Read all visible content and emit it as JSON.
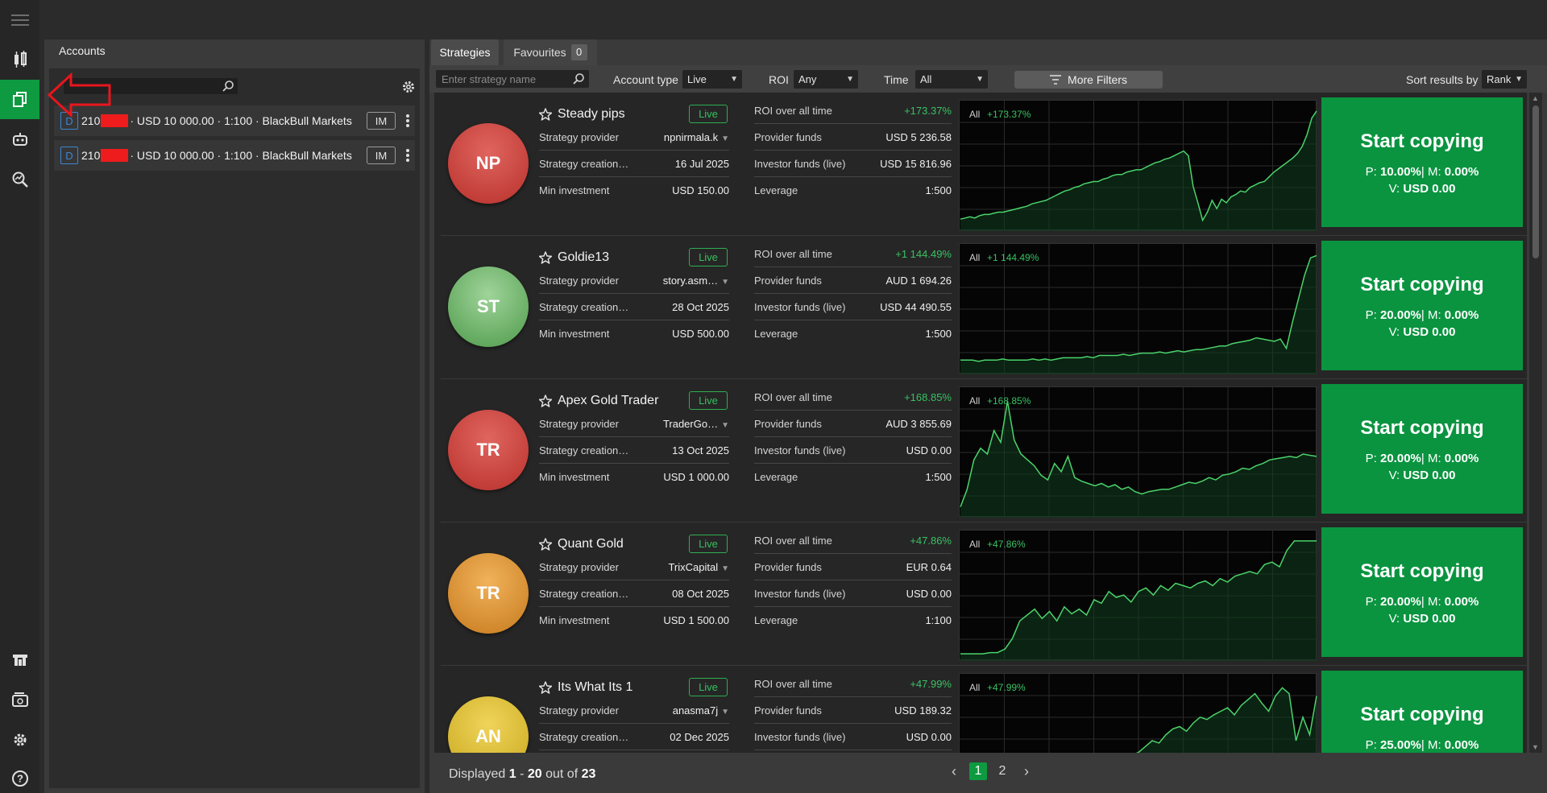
{
  "rail": {
    "icons": [
      "menu-icon",
      "chart-icon",
      "copy-icon",
      "robot-icon",
      "analyze-icon",
      "deposit-icon",
      "wallet-icon",
      "gear-icon",
      "help-icon"
    ]
  },
  "accounts": {
    "title": "Accounts",
    "rows": [
      {
        "badge": "D",
        "number_prefix": "210",
        "details": "· USD 10 000.00 · 1:100 · BlackBull Markets",
        "im": "IM"
      },
      {
        "badge": "D",
        "number_prefix": "210",
        "details": "· USD 10 000.00 · 1:100 · BlackBull Markets",
        "im": "IM"
      }
    ]
  },
  "tabs": {
    "strategies": "Strategies",
    "favourites": "Favourites",
    "favourites_count": "0"
  },
  "filters": {
    "search_placeholder": "Enter strategy name",
    "account_type_label": "Account type",
    "account_type_value": "Live",
    "roi_label": "ROI",
    "roi_value": "Any",
    "time_label": "Time",
    "time_value": "All",
    "more_filters": "More Filters",
    "sort_label": "Sort results by",
    "sort_value": "Rank"
  },
  "labels": {
    "live": "Live",
    "strategy_provider": "Strategy provider",
    "strategy_creation": "Strategy creation…",
    "min_investment": "Min investment",
    "roi_all_time": "ROI over all time",
    "provider_funds": "Provider funds",
    "investor_funds": "Investor funds (live)",
    "leverage": "Leverage",
    "chart_period": "All",
    "start_copying": "Start copying",
    "p": "P:",
    "m": "M:",
    "v": "V:"
  },
  "strategies": [
    {
      "initials": "NP",
      "color_top": "#e0655f",
      "color_bottom": "#b8302b",
      "name": "Steady pips",
      "provider": "npnirmala.k",
      "creation": "16 Jul 2025",
      "min_investment": "USD 150.00",
      "roi": "+173.37%",
      "provider_funds": "USD 5 236.58",
      "investor_funds": "USD 15 816.96",
      "leverage": "1:500",
      "p": "10.00%",
      "m": "0.00%",
      "v": "USD 0.00",
      "series": [
        0.06,
        0.07,
        0.08,
        0.07,
        0.09,
        0.1,
        0.1,
        0.11,
        0.12,
        0.12,
        0.13,
        0.14,
        0.15,
        0.16,
        0.17,
        0.19,
        0.2,
        0.21,
        0.22,
        0.24,
        0.26,
        0.28,
        0.3,
        0.31,
        0.33,
        0.34,
        0.36,
        0.37,
        0.38,
        0.38,
        0.4,
        0.41,
        0.43,
        0.44,
        0.44,
        0.46,
        0.47,
        0.48,
        0.48,
        0.5,
        0.52,
        0.54,
        0.55,
        0.57,
        0.58,
        0.6,
        0.62,
        0.64,
        0.6,
        0.34,
        0.2,
        0.05,
        0.12,
        0.22,
        0.15,
        0.23,
        0.2,
        0.25,
        0.27,
        0.3,
        0.29,
        0.33,
        0.35,
        0.37,
        0.38,
        0.42,
        0.46,
        0.49,
        0.52,
        0.55,
        0.58,
        0.62,
        0.68,
        0.78,
        0.92,
        0.98
      ]
    },
    {
      "initials": "ST",
      "color_top": "#9fd49a",
      "color_bottom": "#4e9a4a",
      "name": "Goldie13",
      "provider": "story.asm…",
      "creation": "28 Oct 2025",
      "min_investment": "USD 500.00",
      "roi": "+1 144.49%",
      "provider_funds": "AUD 1 694.26",
      "investor_funds": "USD 44 490.55",
      "leverage": "1:500",
      "p": "20.00%",
      "m": "0.00%",
      "v": "USD 0.00",
      "series": [
        0.08,
        0.08,
        0.08,
        0.07,
        0.08,
        0.08,
        0.08,
        0.09,
        0.08,
        0.08,
        0.08,
        0.08,
        0.09,
        0.08,
        0.09,
        0.08,
        0.09,
        0.1,
        0.1,
        0.1,
        0.1,
        0.11,
        0.1,
        0.12,
        0.12,
        0.12,
        0.12,
        0.13,
        0.12,
        0.13,
        0.14,
        0.14,
        0.14,
        0.15,
        0.14,
        0.15,
        0.16,
        0.15,
        0.16,
        0.17,
        0.17,
        0.18,
        0.19,
        0.2,
        0.2,
        0.22,
        0.23,
        0.24,
        0.25,
        0.27,
        0.26,
        0.25,
        0.24,
        0.26,
        0.18,
        0.4,
        0.6,
        0.8,
        0.95,
        0.97
      ]
    },
    {
      "initials": "TR",
      "color_top": "#e0655f",
      "color_bottom": "#b8302b",
      "name": "Apex Gold Trader",
      "provider": "TraderGo…",
      "creation": "13 Oct 2025",
      "min_investment": "USD 1 000.00",
      "roi": "+168.85%",
      "provider_funds": "AUD 3 855.69",
      "investor_funds": "USD 0.00",
      "leverage": "1:500",
      "p": "20.00%",
      "m": "0.00%",
      "v": "USD 0.00",
      "series": [
        0.05,
        0.2,
        0.45,
        0.55,
        0.5,
        0.7,
        0.6,
        0.95,
        0.62,
        0.5,
        0.45,
        0.4,
        0.32,
        0.28,
        0.42,
        0.35,
        0.48,
        0.3,
        0.27,
        0.25,
        0.23,
        0.25,
        0.22,
        0.24,
        0.2,
        0.22,
        0.18,
        0.16,
        0.18,
        0.19,
        0.2,
        0.2,
        0.22,
        0.24,
        0.26,
        0.25,
        0.27,
        0.3,
        0.28,
        0.32,
        0.33,
        0.35,
        0.38,
        0.37,
        0.4,
        0.42,
        0.45,
        0.46,
        0.47,
        0.48,
        0.47,
        0.5,
        0.49,
        0.48
      ]
    },
    {
      "initials": "TR",
      "color_top": "#f0b25a",
      "color_bottom": "#c77a1e",
      "name": "Quant Gold",
      "provider": "TrixCapital",
      "creation": "08 Oct 2025",
      "min_investment": "USD 1 500.00",
      "roi": "+47.86%",
      "provider_funds": "EUR 0.64",
      "investor_funds": "USD 0.00",
      "leverage": "1:100",
      "p": "20.00%",
      "m": "0.00%",
      "v": "USD 0.00",
      "series": [
        0.02,
        0.02,
        0.02,
        0.02,
        0.03,
        0.03,
        0.06,
        0.15,
        0.3,
        0.35,
        0.4,
        0.32,
        0.38,
        0.3,
        0.42,
        0.36,
        0.4,
        0.35,
        0.48,
        0.45,
        0.55,
        0.5,
        0.52,
        0.46,
        0.55,
        0.58,
        0.52,
        0.6,
        0.56,
        0.62,
        0.6,
        0.58,
        0.62,
        0.64,
        0.6,
        0.66,
        0.63,
        0.68,
        0.7,
        0.72,
        0.7,
        0.78,
        0.8,
        0.76,
        0.9,
        0.98,
        0.98,
        0.98,
        0.98
      ]
    },
    {
      "initials": "AN",
      "color_top": "#f0d45a",
      "color_bottom": "#c8a81e",
      "name": "Its What Its 1",
      "provider": "anasma7j",
      "creation": "02 Dec 2025",
      "min_investment": "",
      "roi": "+47.99%",
      "provider_funds": "USD 189.32",
      "investor_funds": "USD 0.00",
      "leverage": "",
      "p": "25.00%",
      "m": "0.00%",
      "v": "",
      "series": [
        0.02,
        0.02,
        0.03,
        0.02,
        0.03,
        0.03,
        0.05,
        0.06,
        0.05,
        0.07,
        0.08,
        0.1,
        0.09,
        0.12,
        0.14,
        0.12,
        0.15,
        0.18,
        0.2,
        0.22,
        0.25,
        0.28,
        0.3,
        0.32,
        0.35,
        0.38,
        0.4,
        0.45,
        0.5,
        0.48,
        0.55,
        0.6,
        0.62,
        0.58,
        0.65,
        0.7,
        0.68,
        0.72,
        0.75,
        0.78,
        0.72,
        0.8,
        0.85,
        0.9,
        0.82,
        0.75,
        0.88,
        0.95,
        0.9,
        0.5,
        0.7,
        0.55,
        0.88
      ]
    }
  ],
  "footer": {
    "displayed": "Displayed",
    "from": "1",
    "dash": "-",
    "to": "20",
    "out_of": "out of",
    "total": "23",
    "pages": [
      "1",
      "2"
    ]
  }
}
